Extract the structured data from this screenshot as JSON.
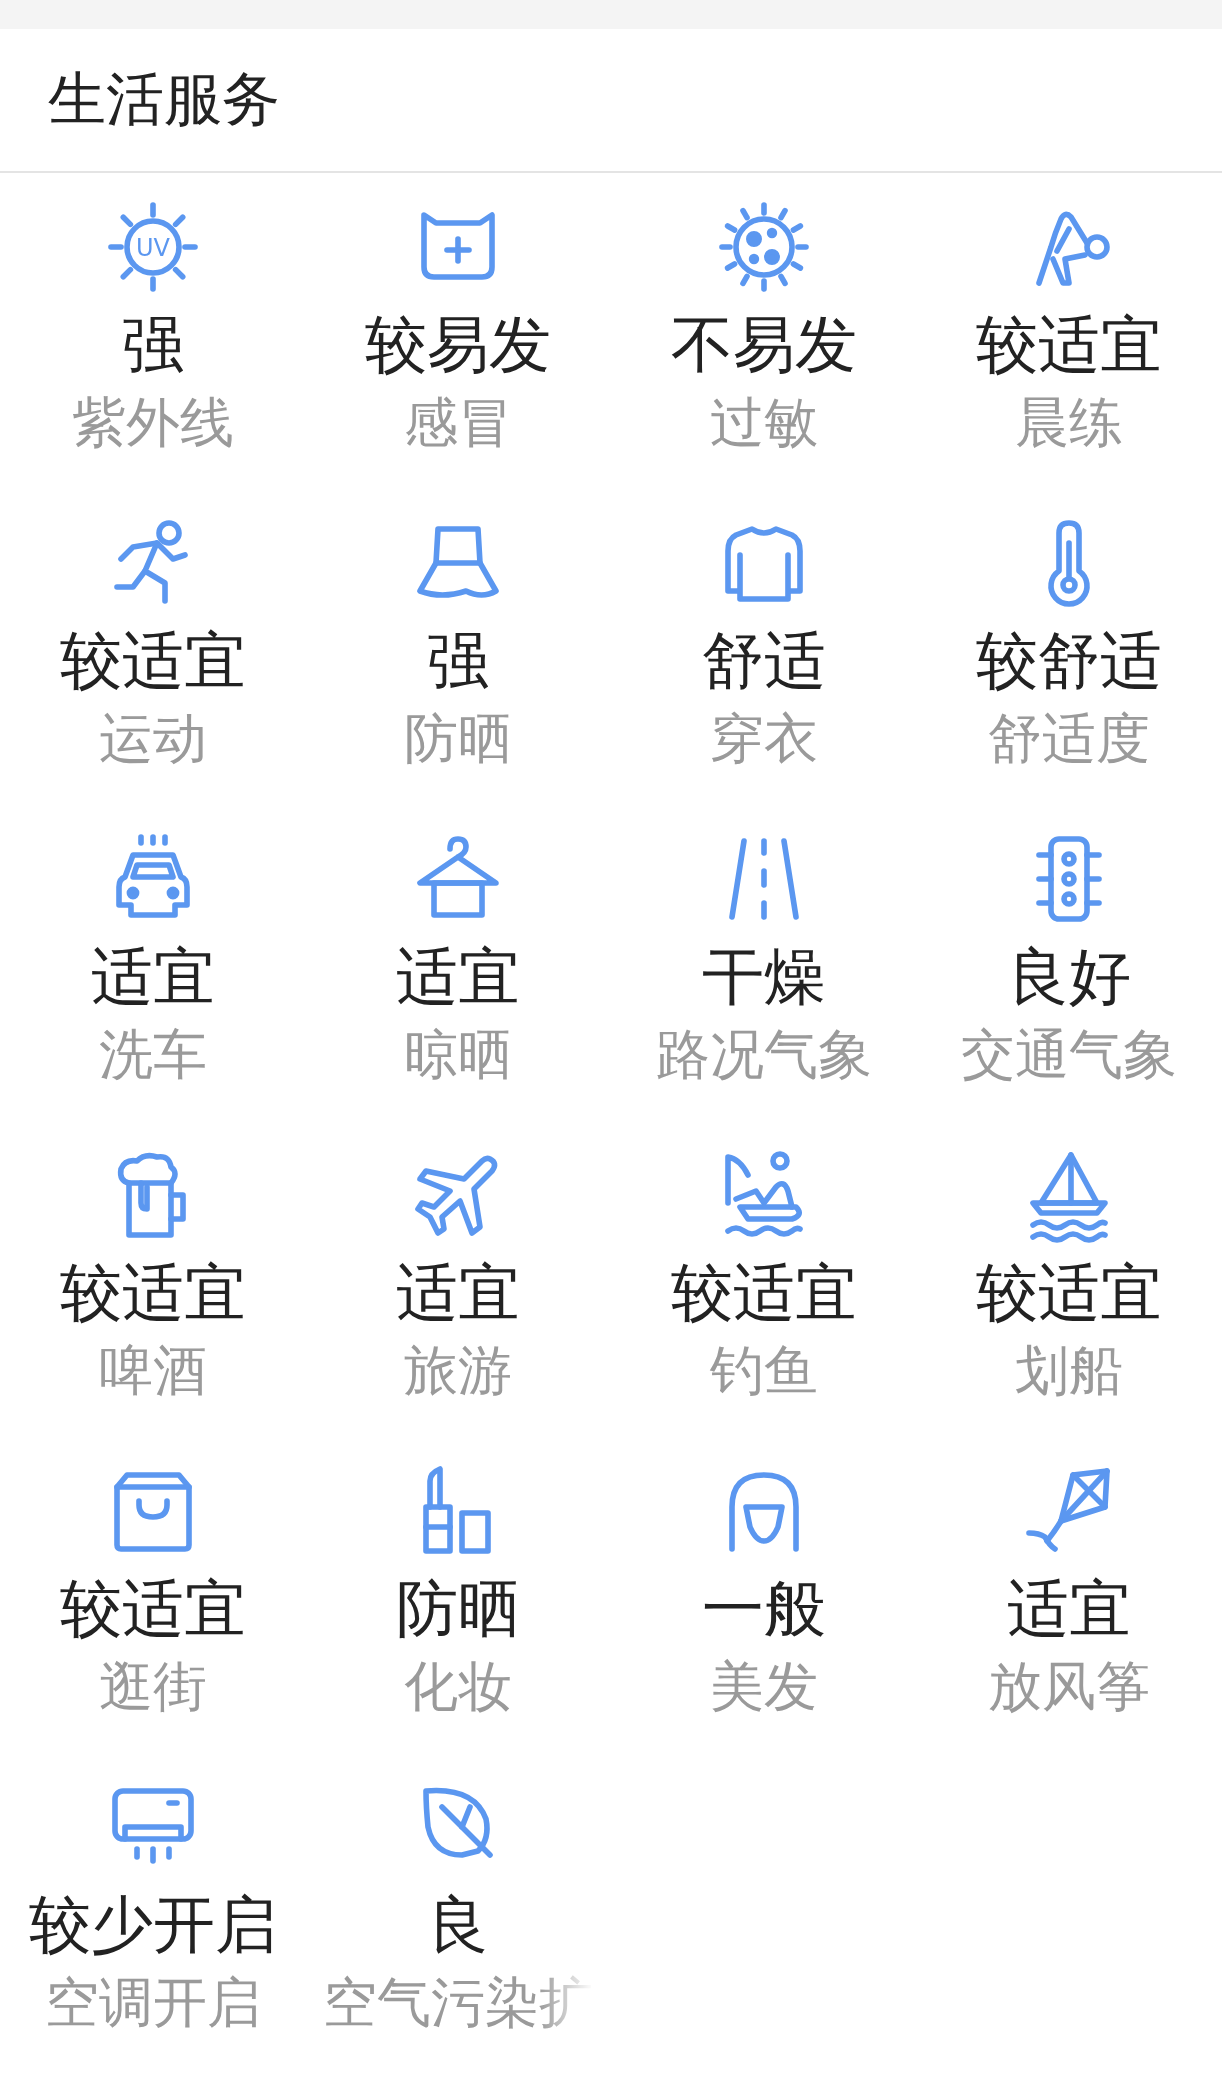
{
  "section": {
    "title": "生活服务"
  },
  "items": [
    {
      "value": "强",
      "label": "紫外线",
      "icon_text": "UV"
    },
    {
      "value": "较易发",
      "label": "感冒"
    },
    {
      "value": "不易发",
      "label": "过敏"
    },
    {
      "value": "较适宜",
      "label": "晨练"
    },
    {
      "value": "较适宜",
      "label": "运动"
    },
    {
      "value": "强",
      "label": "防晒"
    },
    {
      "value": "舒适",
      "label": "穿衣"
    },
    {
      "value": "较舒适",
      "label": "舒适度"
    },
    {
      "value": "适宜",
      "label": "洗车"
    },
    {
      "value": "适宜",
      "label": "晾晒"
    },
    {
      "value": "干燥",
      "label": "路况气象"
    },
    {
      "value": "良好",
      "label": "交通气象"
    },
    {
      "value": "较适宜",
      "label": "啤酒"
    },
    {
      "value": "适宜",
      "label": "旅游"
    },
    {
      "value": "较适宜",
      "label": "钓鱼"
    },
    {
      "value": "较适宜",
      "label": "划船"
    },
    {
      "value": "较适宜",
      "label": "逛街"
    },
    {
      "value": "防晒",
      "label": "化妆"
    },
    {
      "value": "一般",
      "label": "美发"
    },
    {
      "value": "适宜",
      "label": "放风筝"
    },
    {
      "value": "较少开启",
      "label": "空调开启"
    },
    {
      "value": "良",
      "label": "空气污染扩"
    }
  ]
}
